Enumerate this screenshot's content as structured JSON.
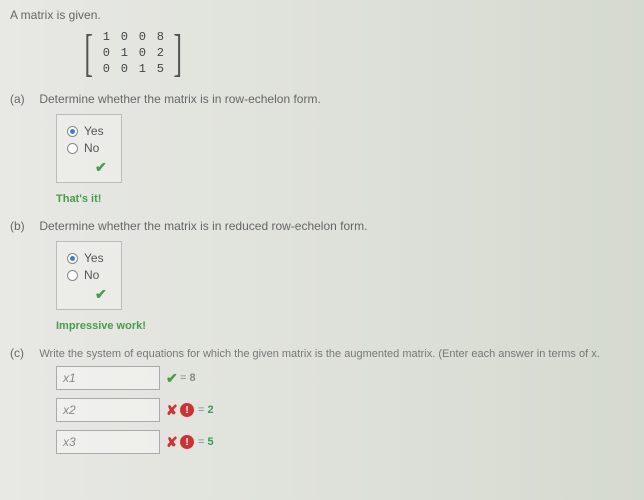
{
  "intro": "A matrix is given.",
  "matrix": {
    "rows": [
      [
        "1",
        "0",
        "0",
        "8"
      ],
      [
        "0",
        "1",
        "0",
        "2"
      ],
      [
        "0",
        "0",
        "1",
        "5"
      ]
    ]
  },
  "parts": {
    "a": {
      "label": "(a)",
      "prompt": "Determine whether the matrix is in row-echelon form.",
      "options": {
        "yes": "Yes",
        "no": "No"
      },
      "selected": "yes",
      "check": "✔",
      "feedback": "That's it!"
    },
    "b": {
      "label": "(b)",
      "prompt": "Determine whether the matrix is in reduced row-echelon form.",
      "options": {
        "yes": "Yes",
        "no": "No"
      },
      "selected": "yes",
      "check": "✔",
      "feedback": "Impressive work!"
    },
    "c": {
      "label": "(c)",
      "prompt": "Write the system of equations for which the given matrix is the augmented matrix. (Enter each answer in terms of x.",
      "rows": [
        {
          "input": "x1",
          "mark": "ok",
          "mark_glyph": "✔",
          "warn": false,
          "eq": "=",
          "rhs": "8"
        },
        {
          "input": "x2",
          "mark": "bad",
          "mark_glyph": "✘",
          "warn": true,
          "eq": "=",
          "rhs": "2"
        },
        {
          "input": "x3",
          "mark": "bad",
          "mark_glyph": "✘",
          "warn": true,
          "eq": "=",
          "rhs": "5"
        }
      ],
      "warn_glyph": "!"
    }
  }
}
